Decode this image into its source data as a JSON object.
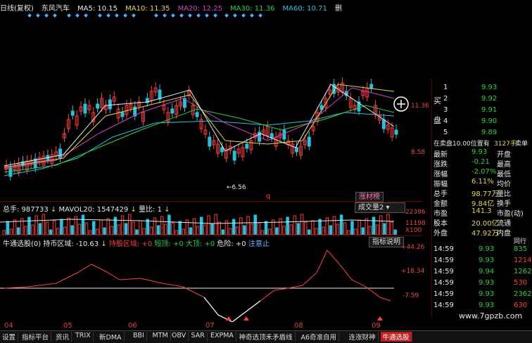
{
  "header": {
    "period": "日线(复权)",
    "stock": "东风汽车",
    "ma5": "MA5: 10.15",
    "ma10": "MA10: 11.35",
    "ma20": "MA20: 12.25",
    "ma30": "MA30: 11.36",
    "ma60": "MA60: 10.71",
    "arrow_down": "↓",
    "arrow_up": "↑",
    "close_box": "删"
  },
  "main_chart": {
    "price_high": "11.36",
    "price_low": "8.58",
    "low_marker": "←6.56",
    "mark_q": "q",
    "tag_button": "涨材榜"
  },
  "volume": {
    "label_total": "总手: 987733",
    "label_mavol": "MAVOL20: 1547429",
    "label_ratio": "量比: 1",
    "dropdown": "成交量2",
    "scale_top": "22396",
    "scale_mid": "11198",
    "scale_unit": "X100"
  },
  "indicator": {
    "name": "牛通选股(0)",
    "hold": "持币区域: -10.63",
    "hold_stock": "持股区域: +0",
    "short": "短顶: +0",
    "big_top": "大顶: +0",
    "danger": "危险: +0",
    "attention": "注意止",
    "help_button": "指标说明",
    "scale_top": "+44.26",
    "scale_mid": "+18.34",
    "scale_low": "-7.59"
  },
  "xaxis": [
    "04",
    "05",
    "06",
    "07",
    "08",
    "09"
  ],
  "right_panel": {
    "buy_label": "买",
    "pan_label": "盘",
    "book": [
      {
        "level": "1",
        "price": "9.93"
      },
      {
        "level": "2",
        "price": "9.92"
      },
      {
        "level": "3",
        "price": "9.91"
      },
      {
        "level": "4",
        "price": "9.90"
      },
      {
        "level": "5",
        "price": "9.89"
      }
    ],
    "sell_status": "在卖盘10.00位置有",
    "sell_qty": "3127手",
    "sell_btn": "卖单",
    "stats": [
      {
        "k": "最新",
        "v": "9.93",
        "k2": "开盘",
        "v2": ""
      },
      {
        "k": "涨跌",
        "v": "-0.21",
        "k2": "最高",
        "v2": ""
      },
      {
        "k": "涨幅",
        "v": "-2.07%",
        "k2": "最低",
        "v2": ""
      },
      {
        "k": "振幅",
        "v": "6.11%",
        "k2": "均价",
        "v2": ""
      },
      {
        "k": "总手",
        "v": "98.77万",
        "k2": "量比",
        "v2": ""
      },
      {
        "k": "金额",
        "v": "9.84亿",
        "k2": "换手",
        "v2": ""
      },
      {
        "k": "市盈",
        "v": "141.3",
        "k2": "市盈(动)",
        "v2": ""
      },
      {
        "k": "股本",
        "v": "20.00亿",
        "k2": "流通",
        "v2": ""
      },
      {
        "k": "外盘",
        "v": "47.92万",
        "k2": "内盘",
        "v2": ""
      }
    ],
    "ticks_header": "同行",
    "ticks": [
      {
        "time": "14:59",
        "price": "9.93",
        "vol": "835"
      },
      {
        "time": "14:59",
        "price": "9.93",
        "vol": "1214"
      },
      {
        "time": "14:59",
        "price": "9.94",
        "vol": "1262"
      },
      {
        "time": "14:59",
        "price": "9.93",
        "vol": "530"
      },
      {
        "time": "14:59",
        "price": "9.93",
        "vol": "2362"
      },
      {
        "time": "14:59",
        "price": "9.93",
        "vol": "630"
      }
    ],
    "watermark": "www.7gpzb.com"
  },
  "tabs": [
    "设置",
    "指标平台",
    "资讯",
    "TRIX",
    "新DMA",
    "BBI",
    "MTM",
    "OBV",
    "SAR",
    "EXPMA",
    "神奇选顶禾矛盾线",
    "A6奇准自用",
    "连涨财神",
    "牛通选股"
  ],
  "active_tab": "牛通选股",
  "colors": {
    "up": "#ff3b3b",
    "down": "#22c3e0",
    "ma5": "#e8e8e8",
    "ma10": "#e7d53f",
    "ma20": "#d63fd0",
    "ma30": "#2bd13b",
    "ma60": "#22c3e0"
  }
}
